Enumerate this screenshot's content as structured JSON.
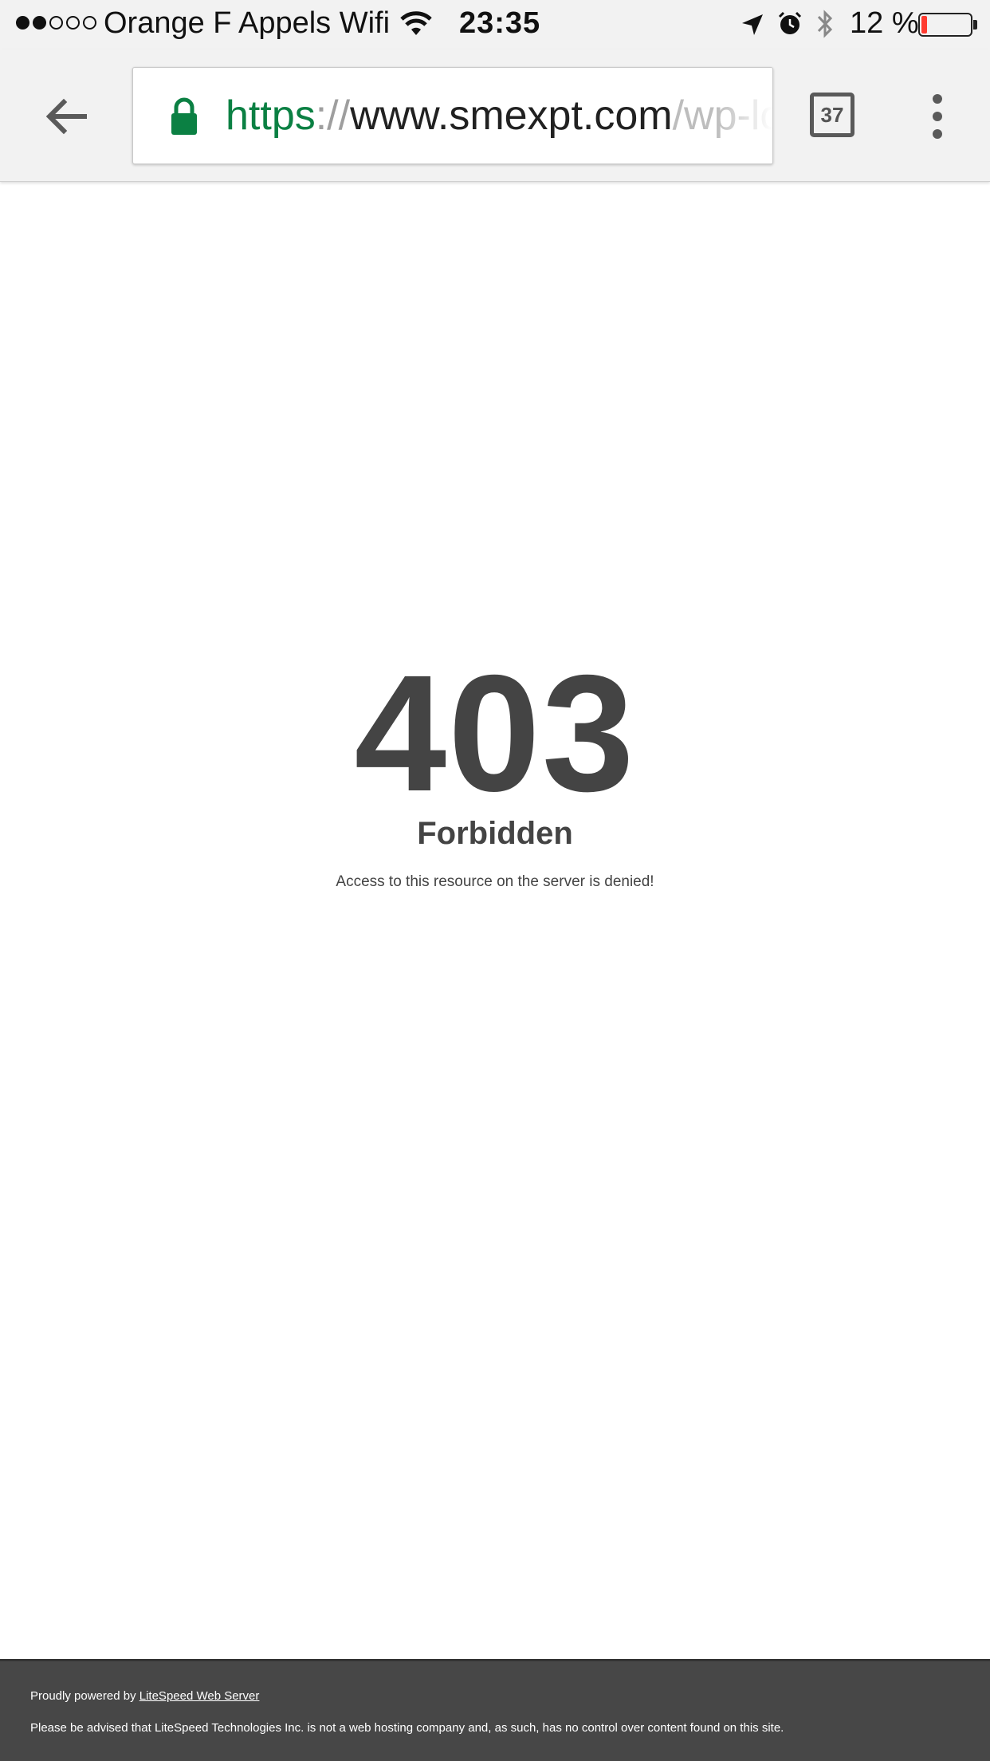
{
  "status_bar": {
    "signal_filled": 2,
    "signal_total": 5,
    "carrier": "Orange F Appels Wifi",
    "time": "23:35",
    "battery_pct": "12 %",
    "battery_level": 0.12,
    "battery_color": "#ff3b30",
    "icons": [
      "wifi-icon",
      "location-arrow-icon",
      "alarm-clock-icon",
      "bluetooth-icon",
      "battery-icon"
    ]
  },
  "browser": {
    "url": {
      "scheme": "https",
      "separator": "://",
      "host": "www.smexpt.com",
      "path": "/wp-lo"
    },
    "tab_count": "37",
    "lock_color": "#0b8043",
    "icons": [
      "back-arrow-icon",
      "lock-icon",
      "tabs-icon",
      "overflow-menu-icon"
    ]
  },
  "page": {
    "code": "403",
    "title": "Forbidden",
    "message": "Access to this resource on the server is denied!"
  },
  "footer": {
    "powered_prefix": "Proudly powered by ",
    "powered_link": "LiteSpeed Web Server",
    "disclaimer": "Please be advised that LiteSpeed Technologies Inc. is not a web hosting company and, as such, has no control over content found on this site."
  }
}
